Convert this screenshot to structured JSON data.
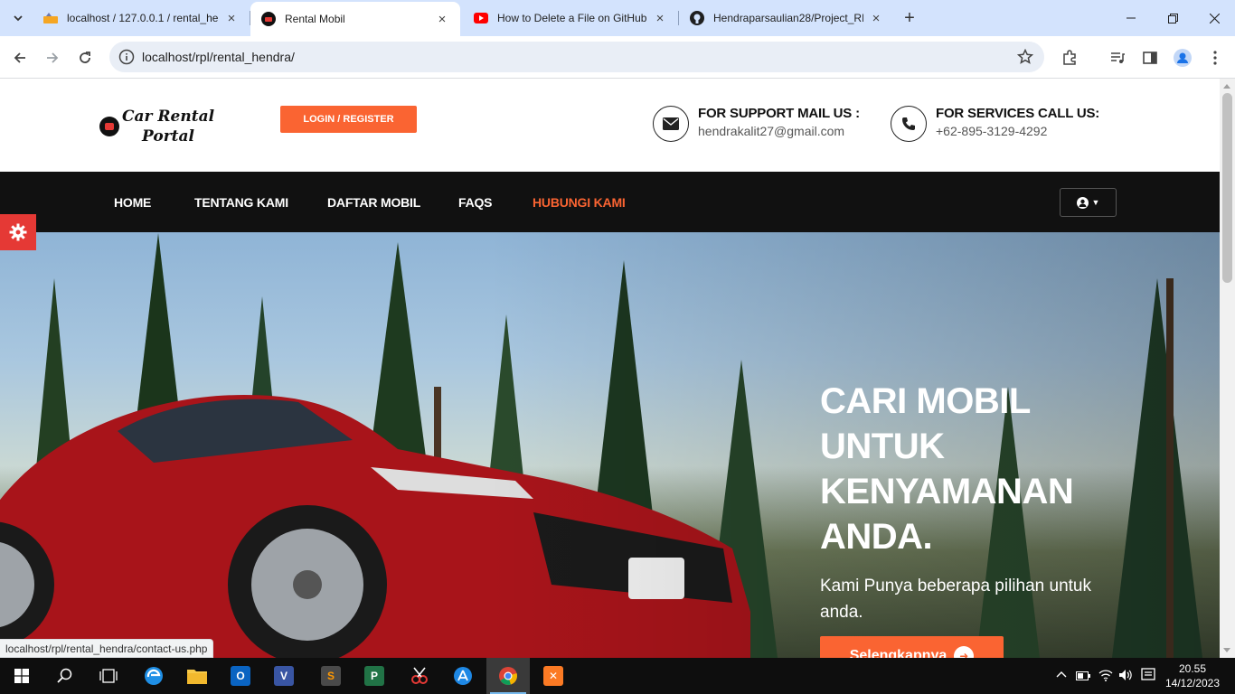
{
  "browser": {
    "tabs": [
      {
        "title": "localhost / 127.0.0.1 / rental_he",
        "icon": "phpmyadmin-icon"
      },
      {
        "title": "Rental Mobil",
        "icon": "site-logo-icon",
        "active": true
      },
      {
        "title": "How to Delete a File on GitHub",
        "icon": "youtube-icon"
      },
      {
        "title": "Hendraparsaulian28/Project_RP",
        "icon": "github-icon"
      }
    ],
    "url": "localhost/rpl/rental_hendra/",
    "status_url": "localhost/rpl/rental_hendra/contact-us.php"
  },
  "header": {
    "logo_line1": "Car Rental",
    "logo_line2": "Portal",
    "login_label": "LOGIN / REGISTER",
    "mail_label": "FOR SUPPORT MAIL US :",
    "mail_value": "hendrakalit27@gmail.com",
    "call_label": "FOR SERVICES CALL US:",
    "call_value": "+62-895-3129-4292"
  },
  "nav": {
    "items": [
      "HOME",
      "TENTANG KAMI",
      "DAFTAR MOBIL",
      "FAQS",
      "HUBUNGI KAMI"
    ],
    "active_index": 4
  },
  "hero": {
    "title": "CARI MOBIL UNTUK KENYAMANAN ANDA.",
    "subtitle": "Kami Punya beberapa pilihan untuk anda.",
    "button_label": "Selengkapnya"
  },
  "taskbar": {
    "time": "20.55",
    "date": "14/12/2023"
  },
  "colors": {
    "accent": "#fa6432",
    "navbar": "#111111",
    "gear_tab": "#e53935"
  }
}
